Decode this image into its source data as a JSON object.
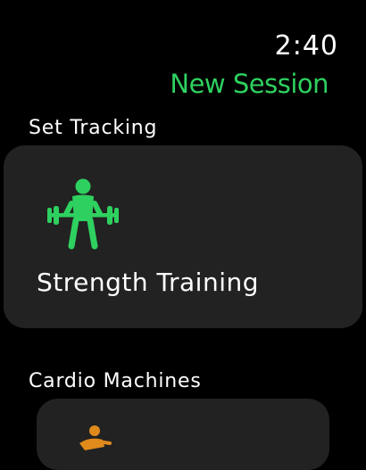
{
  "status": {
    "time": "2:40"
  },
  "header": {
    "title": "New Session"
  },
  "sections": [
    {
      "label": "Set Tracking",
      "card": {
        "title": "Strength Training",
        "icon": "weightlifting-icon",
        "icon_color": "#2ed15f"
      }
    },
    {
      "label": "Cardio Machines",
      "card": {
        "icon": "rowing-icon",
        "icon_color": "#e08a1c"
      }
    }
  ],
  "colors": {
    "accent": "#2ed15f",
    "background": "#000000",
    "card": "#222222",
    "cardio_accent": "#e08a1c"
  }
}
